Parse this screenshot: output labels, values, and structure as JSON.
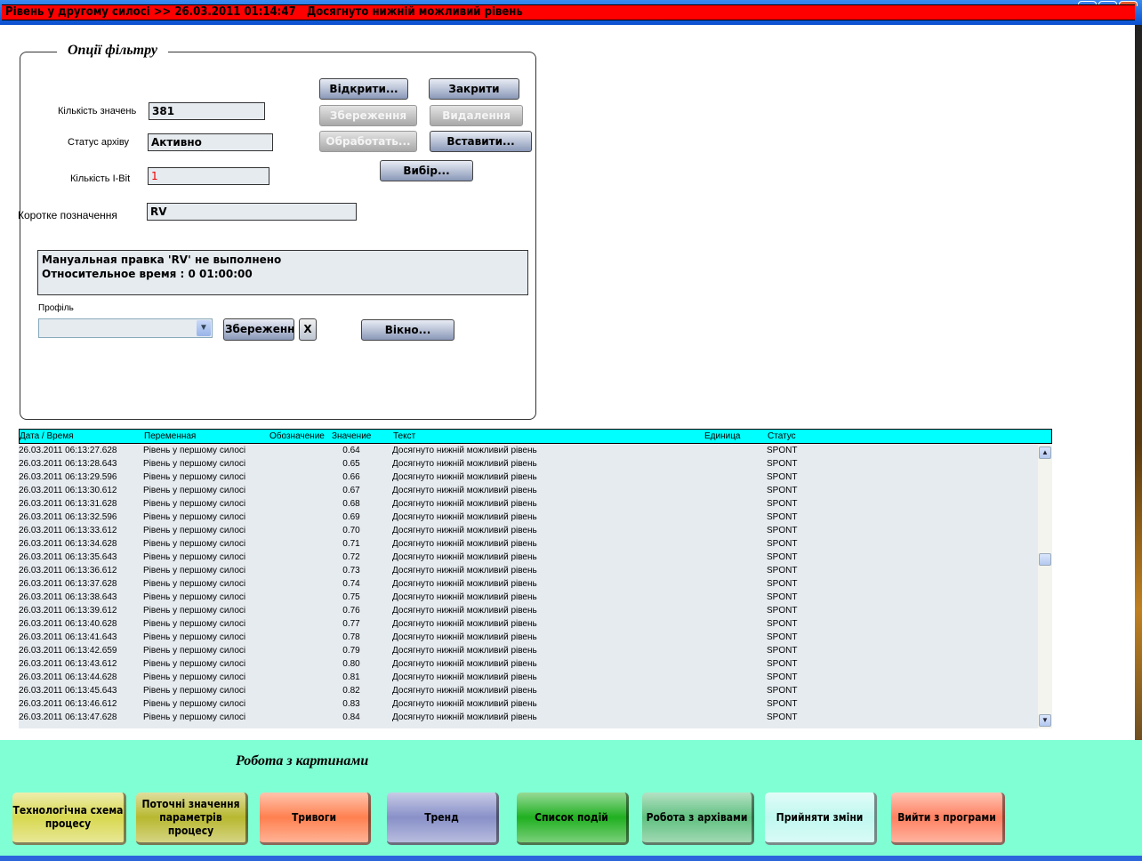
{
  "alarm_bar": {
    "text": "Рівень у другому силосі >> 26.03.2011 01:14:47   Досягнуто нижній можливий рівень"
  },
  "filter": {
    "title": "Опції фільтру",
    "count_label": "Кількість значень",
    "count_value": "381",
    "status_label": "Статус архіву",
    "status_value": "Активно",
    "ibit_label": "Кількість I-Bit",
    "ibit_value": "1",
    "short_label": "Коротке позначення",
    "short_value": "RV",
    "buttons": {
      "open": "Відкрити...",
      "close": "Закрити",
      "save": "Збереження",
      "delete": "Видалення",
      "process": "Обработать...",
      "insert": "Вставити...",
      "select": "Вибір...",
      "window": "Вікно...",
      "profile_save": "Збереження",
      "profile_clear": "X"
    },
    "message_lines": [
      "Мануальная правка 'RV' не выполнено",
      "Относительное время : 0  01:00:00"
    ],
    "profile_label": "Профіль",
    "profile_value": ""
  },
  "table": {
    "columns": [
      "Дата / Время",
      "Переменная",
      "Обозначение",
      "Значение",
      "Текст",
      "Единица",
      "Статус"
    ],
    "rows": [
      [
        "26.03.2011 06:13:27.628",
        "Рівень у першому силосі",
        "",
        "0.64",
        "Досягнуто нижній можливий рівень",
        "",
        "SPONT"
      ],
      [
        "26.03.2011 06:13:28.643",
        "Рівень у першому силосі",
        "",
        "0.65",
        "Досягнуто нижній можливий рівень",
        "",
        "SPONT"
      ],
      [
        "26.03.2011 06:13:29.596",
        "Рівень у першому силосі",
        "",
        "0.66",
        "Досягнуто нижній можливий рівень",
        "",
        "SPONT"
      ],
      [
        "26.03.2011 06:13:30.612",
        "Рівень у першому силосі",
        "",
        "0.67",
        "Досягнуто нижній можливий рівень",
        "",
        "SPONT"
      ],
      [
        "26.03.2011 06:13:31.628",
        "Рівень у першому силосі",
        "",
        "0.68",
        "Досягнуто нижній можливий рівень",
        "",
        "SPONT"
      ],
      [
        "26.03.2011 06:13:32.596",
        "Рівень у першому силосі",
        "",
        "0.69",
        "Досягнуто нижній можливий рівень",
        "",
        "SPONT"
      ],
      [
        "26.03.2011 06:13:33.612",
        "Рівень у першому силосі",
        "",
        "0.70",
        "Досягнуто нижній можливий рівень",
        "",
        "SPONT"
      ],
      [
        "26.03.2011 06:13:34.628",
        "Рівень у першому силосі",
        "",
        "0.71",
        "Досягнуто нижній можливий рівень",
        "",
        "SPONT"
      ],
      [
        "26.03.2011 06:13:35.643",
        "Рівень у першому силосі",
        "",
        "0.72",
        "Досягнуто нижній можливий рівень",
        "",
        "SPONT"
      ],
      [
        "26.03.2011 06:13:36.612",
        "Рівень у першому силосі",
        "",
        "0.73",
        "Досягнуто нижній можливий рівень",
        "",
        "SPONT"
      ],
      [
        "26.03.2011 06:13:37.628",
        "Рівень у першому силосі",
        "",
        "0.74",
        "Досягнуто нижній можливий рівень",
        "",
        "SPONT"
      ],
      [
        "26.03.2011 06:13:38.643",
        "Рівень у першому силосі",
        "",
        "0.75",
        "Досягнуто нижній можливий рівень",
        "",
        "SPONT"
      ],
      [
        "26.03.2011 06:13:39.612",
        "Рівень у першому силосі",
        "",
        "0.76",
        "Досягнуто нижній можливий рівень",
        "",
        "SPONT"
      ],
      [
        "26.03.2011 06:13:40.628",
        "Рівень у першому силосі",
        "",
        "0.77",
        "Досягнуто нижній можливий рівень",
        "",
        "SPONT"
      ],
      [
        "26.03.2011 06:13:41.643",
        "Рівень у першому силосі",
        "",
        "0.78",
        "Досягнуто нижній можливий рівень",
        "",
        "SPONT"
      ],
      [
        "26.03.2011 06:13:42.659",
        "Рівень у першому силосі",
        "",
        "0.79",
        "Досягнуто нижній можливий рівень",
        "",
        "SPONT"
      ],
      [
        "26.03.2011 06:13:43.612",
        "Рівень у першому силосі",
        "",
        "0.80",
        "Досягнуто нижній можливий рівень",
        "",
        "SPONT"
      ],
      [
        "26.03.2011 06:13:44.628",
        "Рівень у першому силосі",
        "",
        "0.81",
        "Досягнуто нижній можливий рівень",
        "",
        "SPONT"
      ],
      [
        "26.03.2011 06:13:45.643",
        "Рівень у першому силосі",
        "",
        "0.82",
        "Досягнуто нижній можливий рівень",
        "",
        "SPONT"
      ],
      [
        "26.03.2011 06:13:46.612",
        "Рівень у першому силосі",
        "",
        "0.83",
        "Досягнуто нижній можливий рівень",
        "",
        "SPONT"
      ],
      [
        "26.03.2011 06:13:47.628",
        "Рівень у першому силосі",
        "",
        "0.84",
        "Досягнуто нижній можливий рівень",
        "",
        "SPONT"
      ]
    ]
  },
  "bottom": {
    "title": "Робота з картинами",
    "buttons": [
      {
        "label": "Технологічна схема процесу",
        "color": "#d8d850"
      },
      {
        "label": "Поточні значення параметрів процесу",
        "color": "#b8b830"
      },
      {
        "label": "Тривоги",
        "color": "#ff8050"
      },
      {
        "label": "Тренд",
        "color": "#8890c8"
      },
      {
        "label": "Список подій",
        "color": "#20b020"
      },
      {
        "label": "Робота з архівами",
        "color": "#60c080"
      },
      {
        "label": "Прийняти зміни",
        "color": "#c0f8f0"
      },
      {
        "label": "Вийти з програми",
        "color": "#ff8060"
      }
    ]
  }
}
